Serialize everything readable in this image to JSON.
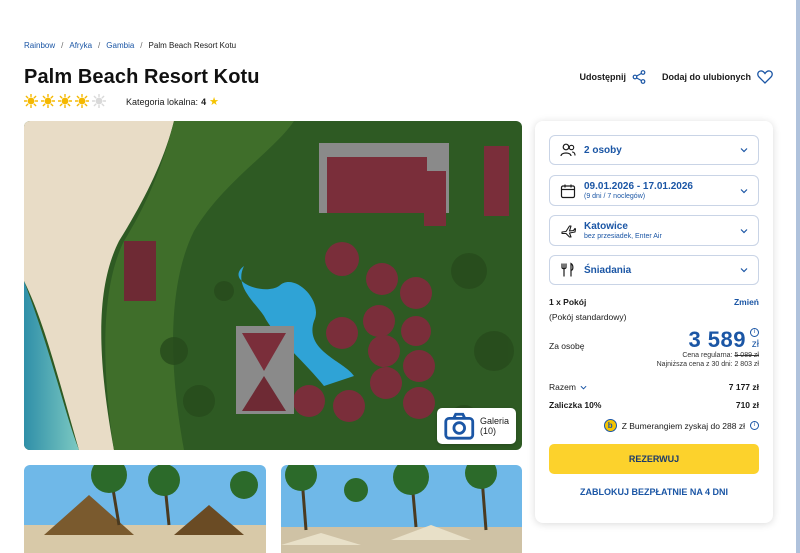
{
  "breadcrumb": [
    "Rainbow",
    "Afryka",
    "Gambia",
    "Palm Beach Resort Kotu"
  ],
  "hotel": {
    "title": "Palm Beach Resort Kotu",
    "suns_filled": 4,
    "suns_total": 5,
    "local_category_label": "Kategoria lokalna:",
    "local_category_value": "4"
  },
  "actions": {
    "share": "Udostępnij",
    "favorite": "Dodaj do ulubionych"
  },
  "gallery": {
    "label": "Galeria (10)"
  },
  "booking": {
    "persons": "2 osoby",
    "dates": "09.01.2026 - 17.01.2026",
    "duration": "(9 dni / 7 noclegów)",
    "departure": "Katowice",
    "transport": "bez przesiadek, Enter Air",
    "board": "Śniadania",
    "room_count": "1 x Pokój",
    "room_change": "Zmień",
    "room_type": "(Pokój standardowy)",
    "per_person_label": "Za osobę",
    "price": "3 589",
    "currency": "zł",
    "regular_label": "Cena regularna:",
    "regular_price": "5 089 zł",
    "lowest_label": "Najniższa cena z 30 dni:",
    "lowest_price": "2 803 zł",
    "total_label": "Razem",
    "total_value": "7 177 zł",
    "deposit_label": "Zaliczka 10%",
    "deposit_value": "710 zł",
    "bumerang_text": "Z Bumerangiem zyskaj do 288 zł",
    "reserve_button": "REZERWUJ",
    "block_link": "ZABLOKUJ BEZPŁATNIE NA 4 DNI"
  },
  "colors": {
    "brand_blue": "#1b56a5",
    "accent_yellow": "#fcd22c",
    "sun_color": "#f5b800"
  }
}
